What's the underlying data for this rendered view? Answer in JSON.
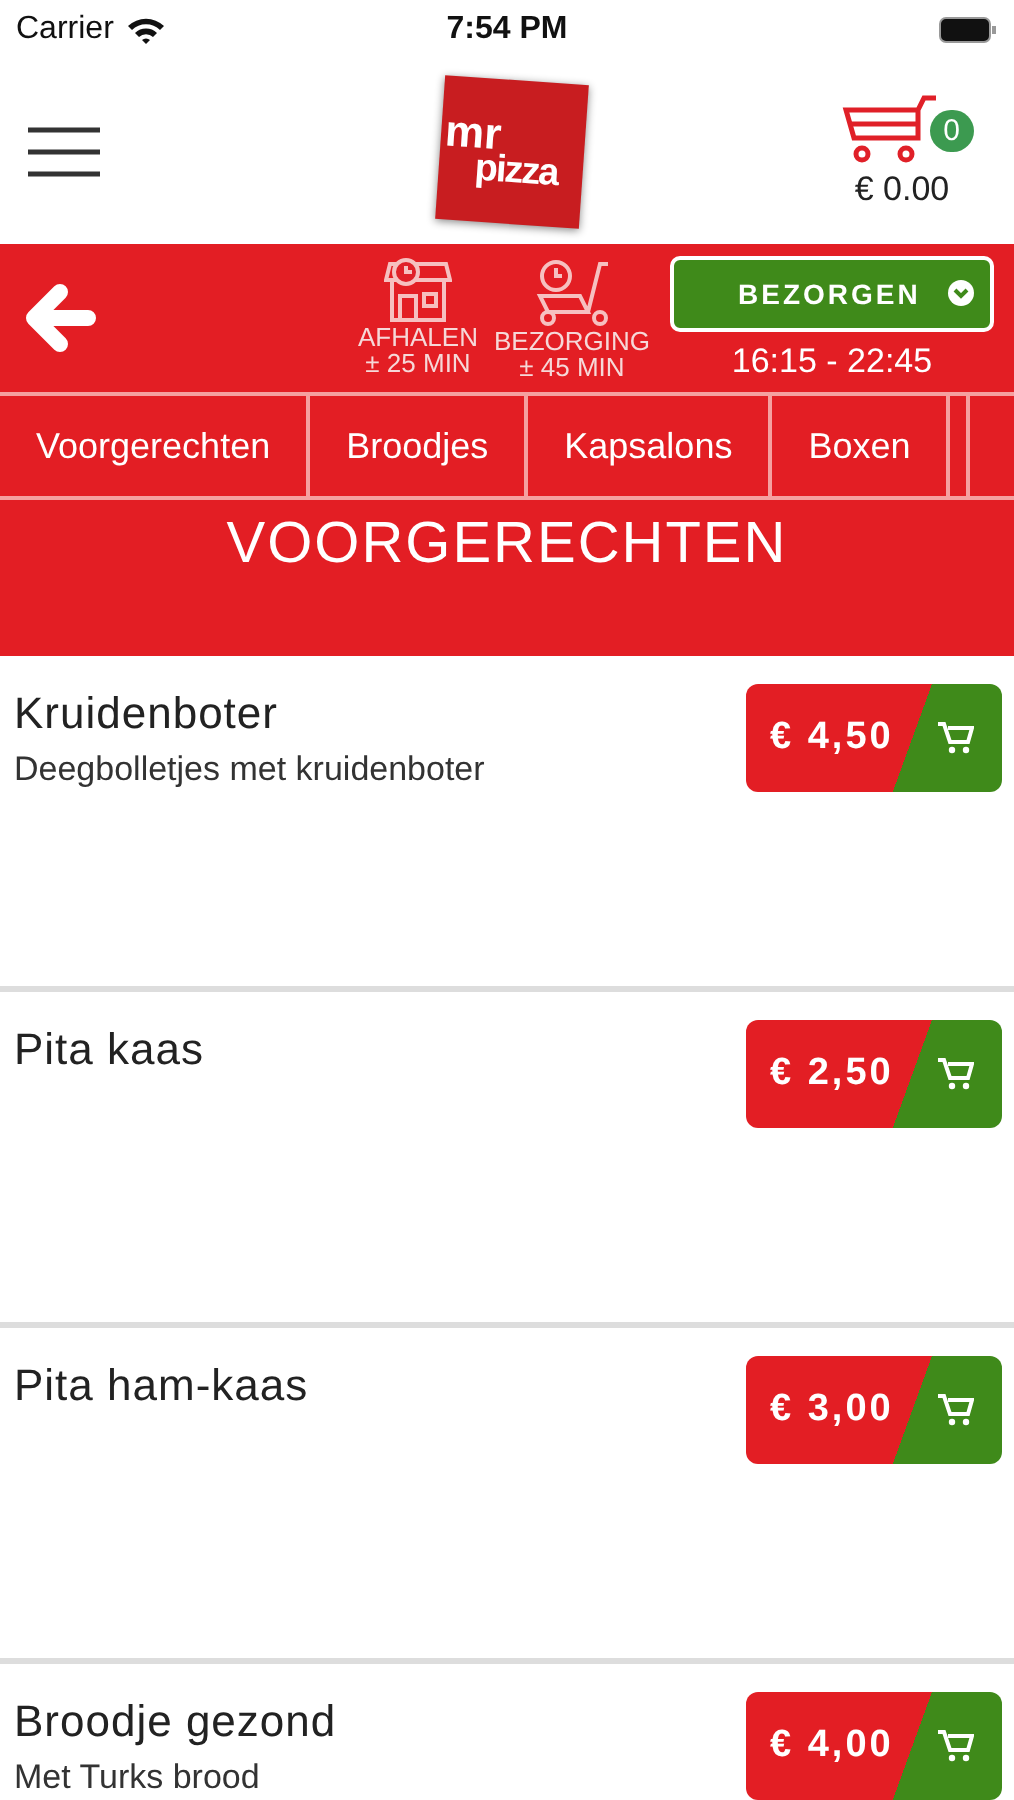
{
  "status_bar": {
    "carrier": "Carrier",
    "time": "7:54 PM"
  },
  "header": {
    "logo": {
      "line_1": "mr",
      "line_2": "pizza"
    },
    "cart": {
      "count": "0",
      "total": "€ 0.00"
    }
  },
  "info_bar": {
    "options": [
      {
        "kind": "pickup",
        "label": "AFHALEN",
        "time": "± 25 MIN"
      },
      {
        "kind": "delivery",
        "label": "BEZORGING",
        "time": "± 45 MIN"
      }
    ],
    "mode_button": "BEZORGEN",
    "hours": "16:15 - 22:45"
  },
  "tabs": [
    {
      "label": "Voorgerechten"
    },
    {
      "label": "Broodjes"
    },
    {
      "label": "Kapsalons"
    },
    {
      "label": "Boxen"
    }
  ],
  "section_title": "VOORGERECHTEN",
  "products": [
    {
      "name": "Kruidenboter",
      "description": "Deegbolletjes met kruidenboter",
      "price": "€ 4,50"
    },
    {
      "name": "Pita kaas",
      "price": "€ 2,50"
    },
    {
      "name": "Pita ham-kaas",
      "price": "€ 3,00"
    },
    {
      "name": "Broodje gezond",
      "description": "Met Turks brood",
      "price": "€ 4,00"
    }
  ]
}
